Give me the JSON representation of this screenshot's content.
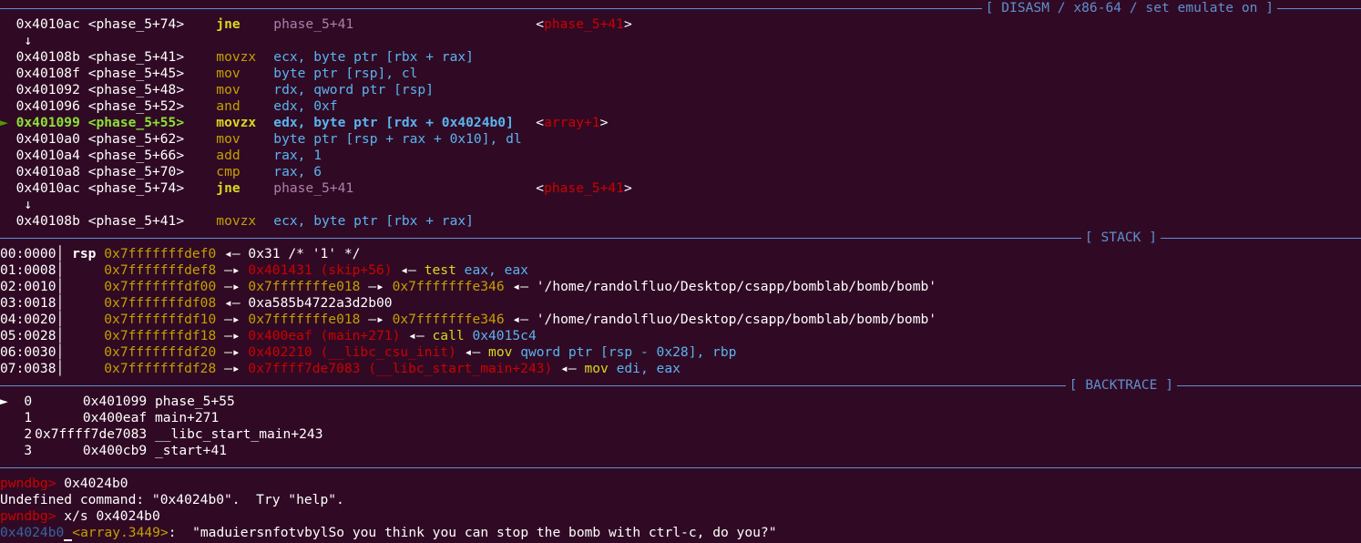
{
  "disasm": {
    "header": "[ DISASM / x86-64 / set emulate on ]",
    "lines": [
      {
        "addr": "0x4010ac",
        "sym": "<phase_5+74>",
        "mn": "jne",
        "ops": "phase_5+41",
        "target": "phase_5+41"
      },
      {
        "arrow": "↓"
      },
      {
        "addr": "0x40108b",
        "sym": "<phase_5+41>",
        "mn": "movzx",
        "ops": "ecx, byte ptr [rbx + rax]"
      },
      {
        "addr": "0x40108f",
        "sym": "<phase_5+45>",
        "mn": "mov",
        "ops": "byte ptr [rsp], cl"
      },
      {
        "addr": "0x401092",
        "sym": "<phase_5+48>",
        "mn": "mov",
        "ops": "rdx, qword ptr [rsp]"
      },
      {
        "addr": "0x401096",
        "sym": "<phase_5+52>",
        "mn": "and",
        "ops": "edx, 0xf"
      },
      {
        "addr": "0x401099",
        "sym": "<phase_5+55>",
        "mn": "movzx",
        "ops": "edx, byte ptr [rdx + 0x4024b0]",
        "target": "array+1",
        "current": true,
        "marker": "►"
      },
      {
        "addr": "0x4010a0",
        "sym": "<phase_5+62>",
        "mn": "mov",
        "ops": "byte ptr [rsp + rax + 0x10], dl"
      },
      {
        "addr": "0x4010a4",
        "sym": "<phase_5+66>",
        "mn": "add",
        "ops": "rax, 1"
      },
      {
        "addr": "0x4010a8",
        "sym": "<phase_5+70>",
        "mn": "cmp",
        "ops": "rax, 6"
      },
      {
        "addr": "0x4010ac",
        "sym": "<phase_5+74>",
        "mn": "jne",
        "ops": "phase_5+41",
        "target": "phase_5+41"
      },
      {
        "arrow": "↓"
      },
      {
        "addr": "0x40108b",
        "sym": "<phase_5+41>",
        "mn": "movzx",
        "ops": "ecx, byte ptr [rbx + rax]"
      }
    ]
  },
  "stack": {
    "header": "[ STACK ]",
    "rows": [
      {
        "idx": "00:0000",
        "reg": "rsp",
        "addr": "0x7fffffffdef0",
        "chain": "◂— 0x31 /* '1' */"
      },
      {
        "idx": "01:0008",
        "addr": "0x7fffffffdef8",
        "p1": "0x401431 (skip+56)",
        "tail": "◂— test eax, eax"
      },
      {
        "idx": "02:0010",
        "addr": "0x7fffffffdf00",
        "p1": "0x7fffffffe018",
        "p2": "0x7fffffffe346",
        "tail": "◂— '/home/randolfluo/Desktop/csapp/bomblab/bomb/bomb'"
      },
      {
        "idx": "03:0018",
        "addr": "0x7fffffffdf08",
        "chain": "◂— 0xa585b4722a3d2b00"
      },
      {
        "idx": "04:0020",
        "addr": "0x7fffffffdf10",
        "p1": "0x7fffffffe018",
        "p2": "0x7fffffffe346",
        "tail": "◂— '/home/randolfluo/Desktop/csapp/bomblab/bomb/bomb'"
      },
      {
        "idx": "05:0028",
        "addr": "0x7fffffffdf18",
        "p1": "0x400eaf (main+271)",
        "tail": "◂— call 0x4015c4"
      },
      {
        "idx": "06:0030",
        "addr": "0x7fffffffdf20",
        "p1": "0x402210 (__libc_csu_init)",
        "tail": "◂— mov qword ptr [rsp - 0x28], rbp"
      },
      {
        "idx": "07:0038",
        "addr": "0x7fffffffdf28",
        "p1": "0x7ffff7de7083 (__libc_start_main+243)",
        "tail": "◂— mov edi, eax"
      }
    ]
  },
  "backtrace": {
    "header": "[ BACKTRACE ]",
    "frames": [
      {
        "marker": "►",
        "n": "0",
        "addr": "0x401099",
        "sym": "phase_5+55"
      },
      {
        "n": "1",
        "addr": "0x400eaf",
        "sym": "main+271"
      },
      {
        "n": "2",
        "addr": "0x7ffff7de7083",
        "sym": "__libc_start_main+243"
      },
      {
        "n": "3",
        "addr": "0x400cb9",
        "sym": "_start+41"
      }
    ]
  },
  "console": {
    "prompt": "pwndbg>",
    "cmd1": " 0x4024b0",
    "err": "Undefined command: \"0x4024b0\".  Try \"help\".",
    "cmd2": " x/s 0x4024b0",
    "out_addr": "0x4024b0",
    "out_sym": "<array.3449>",
    "out_rest": ":  \"maduiersnfotvbylSo you think you can stop the bomb with ctrl-c, do you?\""
  },
  "colors": {
    "background": "#300a24",
    "separator": "#5f8fcf"
  }
}
